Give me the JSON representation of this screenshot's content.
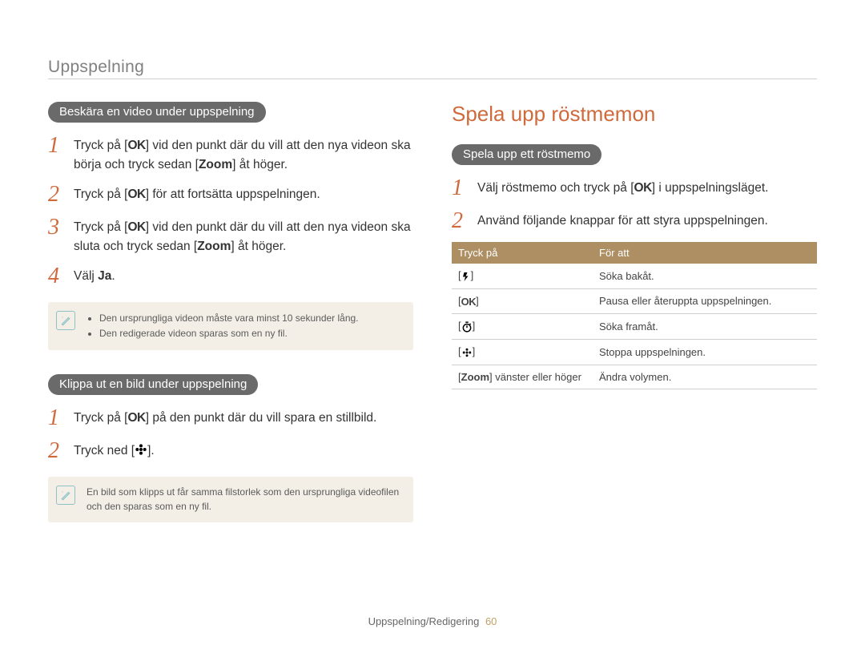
{
  "header": "Uppspelning",
  "left": {
    "section1_pill": "Beskära en video under uppspelning",
    "steps1": [
      {
        "num": "1",
        "pre": "Tryck på [",
        "key": "OK",
        "post": "] vid den punkt där du vill att den nya videon ska börja och tryck sedan [",
        "zoom": "Zoom",
        "tail": "] åt höger."
      },
      {
        "num": "2",
        "pre": "Tryck på [",
        "key": "OK",
        "post": "] för att fortsätta uppspelningen."
      },
      {
        "num": "3",
        "pre": "Tryck på [",
        "key": "OK",
        "post": "] vid den punkt där du vill att den nya videon ska sluta och tryck sedan [",
        "zoom": "Zoom",
        "tail": "] åt höger."
      },
      {
        "num": "4",
        "pre": "Välj ",
        "strong": "Ja",
        "post2": "."
      }
    ],
    "note1": [
      "Den ursprungliga videon måste vara minst 10 sekunder lång.",
      "Den redigerade videon sparas som en ny fil."
    ],
    "section2_pill": "Klippa ut en bild under uppspelning",
    "steps2": [
      {
        "num": "1",
        "pre": "Tryck på [",
        "key": "OK",
        "post": "] på den punkt där du vill spara en stillbild."
      },
      {
        "num": "2",
        "pre": "Tryck ned [",
        "icon": "flower",
        "post": "]."
      }
    ],
    "note2": "En bild som klipps ut får samma filstorlek som den ursprungliga videofilen och den sparas som en ny fil."
  },
  "right": {
    "title": "Spela upp röstmemon",
    "pill": "Spela upp ett röstmemo",
    "steps": [
      {
        "num": "1",
        "pre": "Välj röstmemo och tryck på [",
        "key": "OK",
        "post": "] i uppspelningsläget."
      },
      {
        "num": "2",
        "text": "Använd följande knappar för att styra uppspelningen."
      }
    ],
    "table": {
      "head": [
        "Tryck på",
        "För att"
      ],
      "rows": [
        {
          "key_icon": "flash",
          "desc": "Söka bakåt."
        },
        {
          "key_icon": "OK",
          "desc": "Pausa eller återuppta uppspelningen."
        },
        {
          "key_icon": "timer",
          "desc": "Söka framåt."
        },
        {
          "key_icon": "flower",
          "desc": "Stoppa uppspelningen."
        },
        {
          "key_text_pre": "[",
          "key_text_zoom": "Zoom",
          "key_text_post": "] vänster eller höger",
          "desc": "Ändra volymen."
        }
      ]
    }
  },
  "footer": {
    "text": "Uppspelning/Redigering",
    "page": "60"
  }
}
